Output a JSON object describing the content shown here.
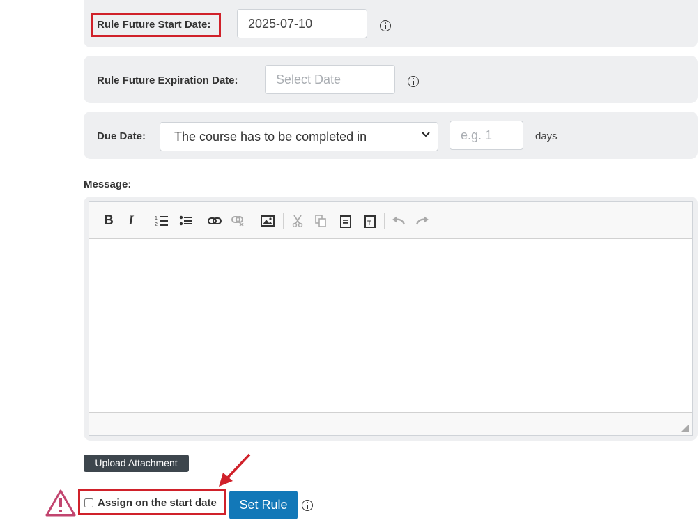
{
  "start_date": {
    "label": "Rule Future Start Date:",
    "value": "2025-07-10",
    "info_icon": "info-icon"
  },
  "expiration_date": {
    "label": "Rule Future Expiration Date:",
    "placeholder": "Select Date",
    "info_icon": "info-icon"
  },
  "due_date": {
    "label": "Due Date:",
    "selected": "The course has to be completed in",
    "placeholder": "e.g. 1",
    "unit": "days"
  },
  "message": {
    "label": "Message:",
    "toolbar": [
      "bold-icon",
      "italic-icon",
      "numbered-list-icon",
      "bulleted-list-icon",
      "link-icon",
      "unlink-icon",
      "image-icon",
      "cut-icon",
      "copy-icon",
      "paste-icon",
      "paste-text-icon",
      "undo-icon",
      "redo-icon"
    ]
  },
  "upload_label": "Upload Attachment",
  "assign_label": "Assign on the start date",
  "set_rule_label": "Set Rule",
  "highlight_color": "#d0212a",
  "warning_color": "#c2456f",
  "primary_color": "#1278b8"
}
